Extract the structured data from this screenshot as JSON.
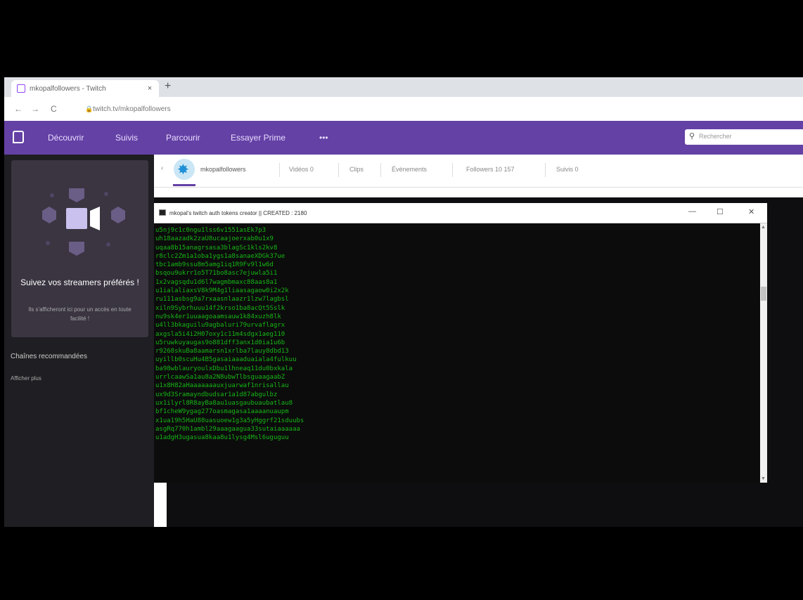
{
  "browser": {
    "tab_title": "mkopalfollowers - Twitch",
    "tab_close": "×",
    "new_tab": "+",
    "nav_back": "←",
    "nav_forward": "→",
    "nav_reload": "C",
    "url": "twitch.tv/mkopalfollowers"
  },
  "twitch_nav": {
    "items": [
      "Découvrir",
      "Suivis",
      "Parcourir",
      "Essayer Prime",
      "•••"
    ],
    "search_placeholder": "Rechercher",
    "accent_color": "#6441a5"
  },
  "sidebar": {
    "promo_title": "Suivez vos streamers préférés !",
    "promo_text": "Ils s'afficheront ici pour un accès en toute facilité !",
    "recommended_heading": "Chaînes recommandées",
    "show_more": "Afficher plus"
  },
  "channel": {
    "name": "mkopalfollowers",
    "tabs": [
      "Vidéos 0",
      "Clips",
      "Événements",
      "Followers 10 157",
      "Suivis 0"
    ]
  },
  "console": {
    "title": "mkopal's twitch auth tokens creator || CREATED : 2180",
    "minimize": "—",
    "maximize": "☐",
    "close": "✕",
    "text_color": "#16b616",
    "lines": [
      "u5nj9c1c0ngu1lss6v1551asEk7p3",
      "uh18aazadk2zaU8ucaajoerxab0u1x9",
      "uqaa8b15anagrsasa3blagSc1kls2kv8",
      "r8clc2Zm1a1oba1ygs1a8sanaeXDGk37ue",
      "tbc1amb9ssu8m5amg1iq1R9Fv9l1w6d",
      "bsqou9ukrr1o5T71bo8asc7ejuwla5i1",
      "1x2vagsqdu1d6l7wagmbmaxc88aas8a1",
      "u1ialaliaxsV8k9M4g1liaasagaow0i2x2k",
      "ru111asbsg9a7rxaasnlaazr1lzw7lagbsl",
      "xiln9Sybrhuuu14f2krso1ba8acQt5Sslk",
      "nu9sk4er1uuaagoaamsauw1k84xuzh8lk",
      "u4ll3bkaguilu9agbaluri79urvaflagrx",
      "axgsla5i4i2H07oxy1c11m4sdgx1aeg110",
      "u5ruwkuyaugas9o881dff3anx1d0ia1u6b",
      "r9268skuBa8aamarsn1xrlba7lauy8dbd13",
      "uyillb0scuHu4B5gasaiaaaduaiala4fulkuu",
      "ba98wblauryoulxDbu1lhneaq11du0bxkala",
      "urrlcaawSa1au8a2N8ubwTlbsguaagaabZ",
      "u1x8H82aHaaaaaaauxjuarwaf1nrisallau",
      "ux9d3Sramayndbudsar1a1d87abgulbz",
      "ux1ilyrl8R8ayBa8au1uasgaubuaubatlau8",
      "bf1cheW9ygag277oasmagasa1aaaanuaupm",
      "x1ua19h5HaU88uasuoew1g3a5yHggrf21sduubs",
      "asgRq770h1ambl29aaagaagua33sutaiaaaaaa",
      "u1adgH3ugasua8kaa8u1lysg4Msl6uguguu"
    ]
  }
}
